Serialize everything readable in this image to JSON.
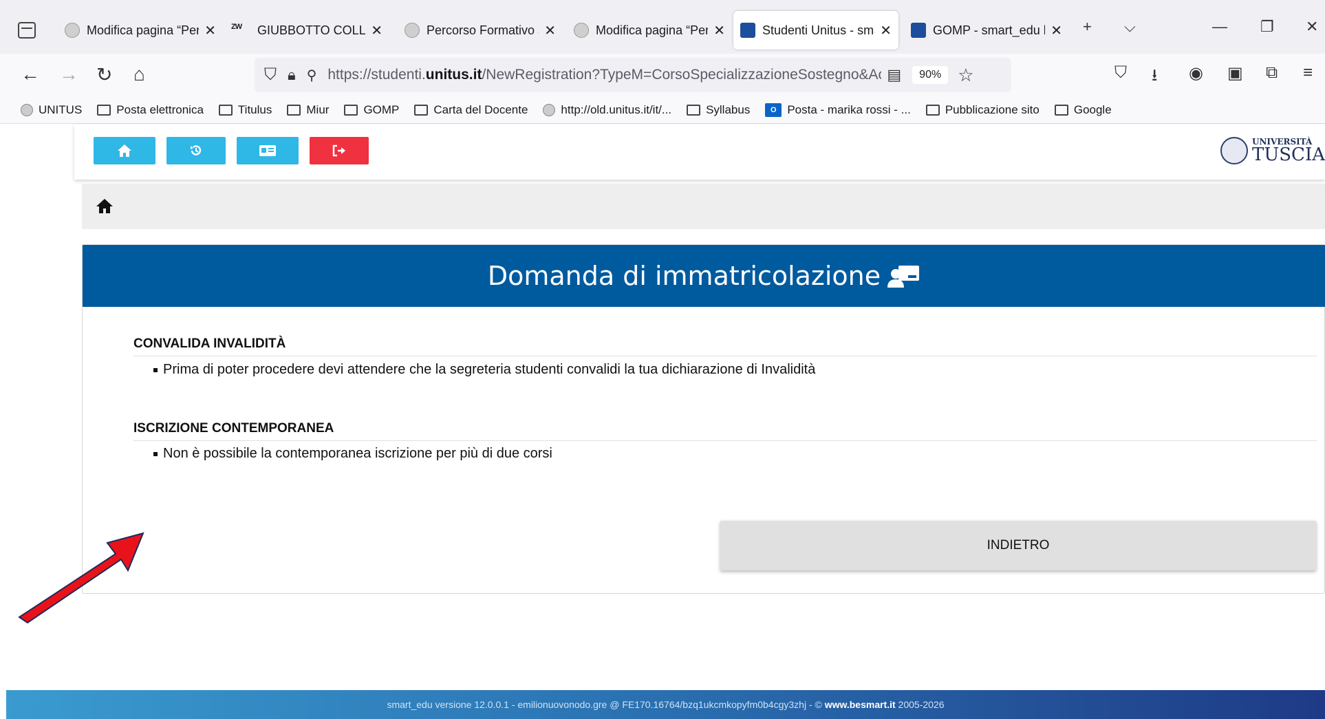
{
  "browser": {
    "tabs": [
      {
        "title": "Modifica pagina “Per",
        "favicon": "unitus-globe-icon"
      },
      {
        "title": "GIUBBOTTO COLLO A",
        "favicon": "zw-icon"
      },
      {
        "title": "Percorso Formativo a",
        "favicon": "unitus-globe-icon"
      },
      {
        "title": "Modifica pagina “Per",
        "favicon": "unitus-globe-icon"
      },
      {
        "title": "Studenti Unitus - sma",
        "favicon": "gomp-icon",
        "active": true
      },
      {
        "title": "GOMP - smart_edu b",
        "favicon": "gomp-icon"
      }
    ],
    "url_prefix": "https://studenti.",
    "url_domain": "unitus.it",
    "url_path": "/NewRegistration?TypeM=CorsoSpecializzazioneSostegno&Accaden",
    "zoom": "90%",
    "bookmarks": [
      {
        "label": "UNITUS",
        "icon": "globe-icon"
      },
      {
        "label": "Posta elettronica",
        "icon": "folder-icon"
      },
      {
        "label": "Titulus",
        "icon": "folder-icon"
      },
      {
        "label": "Miur",
        "icon": "folder-icon"
      },
      {
        "label": "GOMP",
        "icon": "folder-icon"
      },
      {
        "label": "Carta del Docente",
        "icon": "folder-icon"
      },
      {
        "label": "http://old.unitus.it/it/...",
        "icon": "globe-icon"
      },
      {
        "label": "Syllabus",
        "icon": "folder-icon"
      },
      {
        "label": "Posta - marika rossi - ...",
        "icon": "outlook-icon"
      },
      {
        "label": "Pubblicazione sito",
        "icon": "folder-icon"
      },
      {
        "label": "Google",
        "icon": "folder-icon"
      }
    ],
    "zw_logo": "ZW"
  },
  "page": {
    "toolbar": {
      "home_color": "#2fb7e6",
      "history_color": "#2fb7e6",
      "card_color": "#2fb7e6",
      "logout_color": "#f0313f"
    },
    "logo": {
      "line1": "UNIVERSITÀ",
      "line2": "TUSCIA"
    },
    "card": {
      "title": "Domanda di immatricolazione",
      "header_color": "#005a9e",
      "sections": [
        {
          "title": "CONVALIDA INVALIDITÀ",
          "item": "Prima di poter procedere devi attendere che la segreteria studenti convalidi la tua dichiarazione di Invalidità"
        },
        {
          "title": "ISCRIZIONE CONTEMPORANEA",
          "item": "Non è possibile la contemporanea iscrizione per più di due corsi"
        }
      ],
      "back_button": "INDIETRO"
    },
    "footer": {
      "text": "smart_edu versione 12.0.0.1 - emilionuovonodo.gre @ FE170.16764/bzq1ukcmkopyfm0b4cgy3zhj - ©",
      "link": "www.besmart.it",
      "years": "2005-2026"
    }
  }
}
